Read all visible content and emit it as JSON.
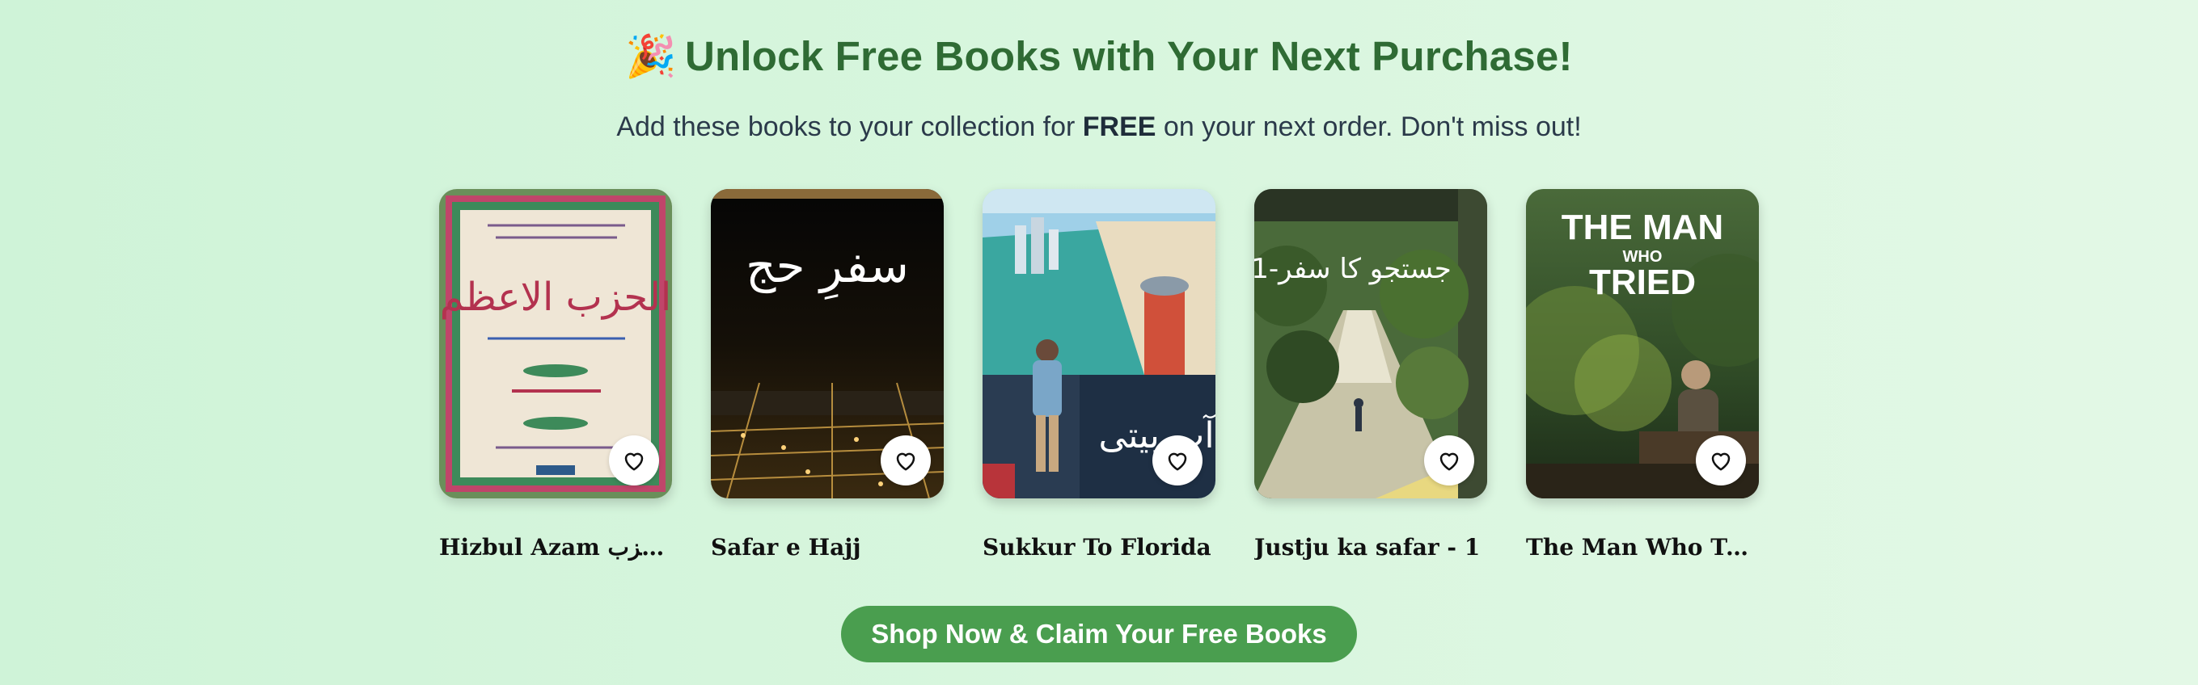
{
  "promo": {
    "emoji": "🎉",
    "headline": "Unlock Free Books with Your Next Purchase!",
    "sub_before": "Add these books to your collection for ",
    "sub_bold": "FREE",
    "sub_after": " on your next order. Don't miss out!"
  },
  "books": [
    {
      "title": "Hizbul Azam الحزب...",
      "cover_text": "الحزب الاعظم",
      "cover_icon": "book-cover-calligraphy"
    },
    {
      "title": "Safar e Hajj",
      "cover_text": "سفرِ حج",
      "cover_icon": "book-cover-city-night"
    },
    {
      "title": "Sukkur To Florida",
      "cover_text": "آپ بیتی",
      "cover_icon": "book-cover-traveler"
    },
    {
      "title": "Justju ka safar - 1",
      "cover_text": "جستجو کا سفر-1",
      "cover_icon": "book-cover-forest-path"
    },
    {
      "title": "The Man Who Tried",
      "cover_line1": "THE MAN",
      "cover_line2": "WHO",
      "cover_line3": "TRIED",
      "cover_icon": "book-cover-man-reading"
    }
  ],
  "cta": {
    "label": "Shop Now & Claim Your Free Books"
  },
  "colors": {
    "headline": "#2f6b34",
    "cta_bg": "#4a9e4f",
    "page_bg": "#d3f4da"
  },
  "icons": {
    "wishlist": "heart-outline-icon"
  }
}
